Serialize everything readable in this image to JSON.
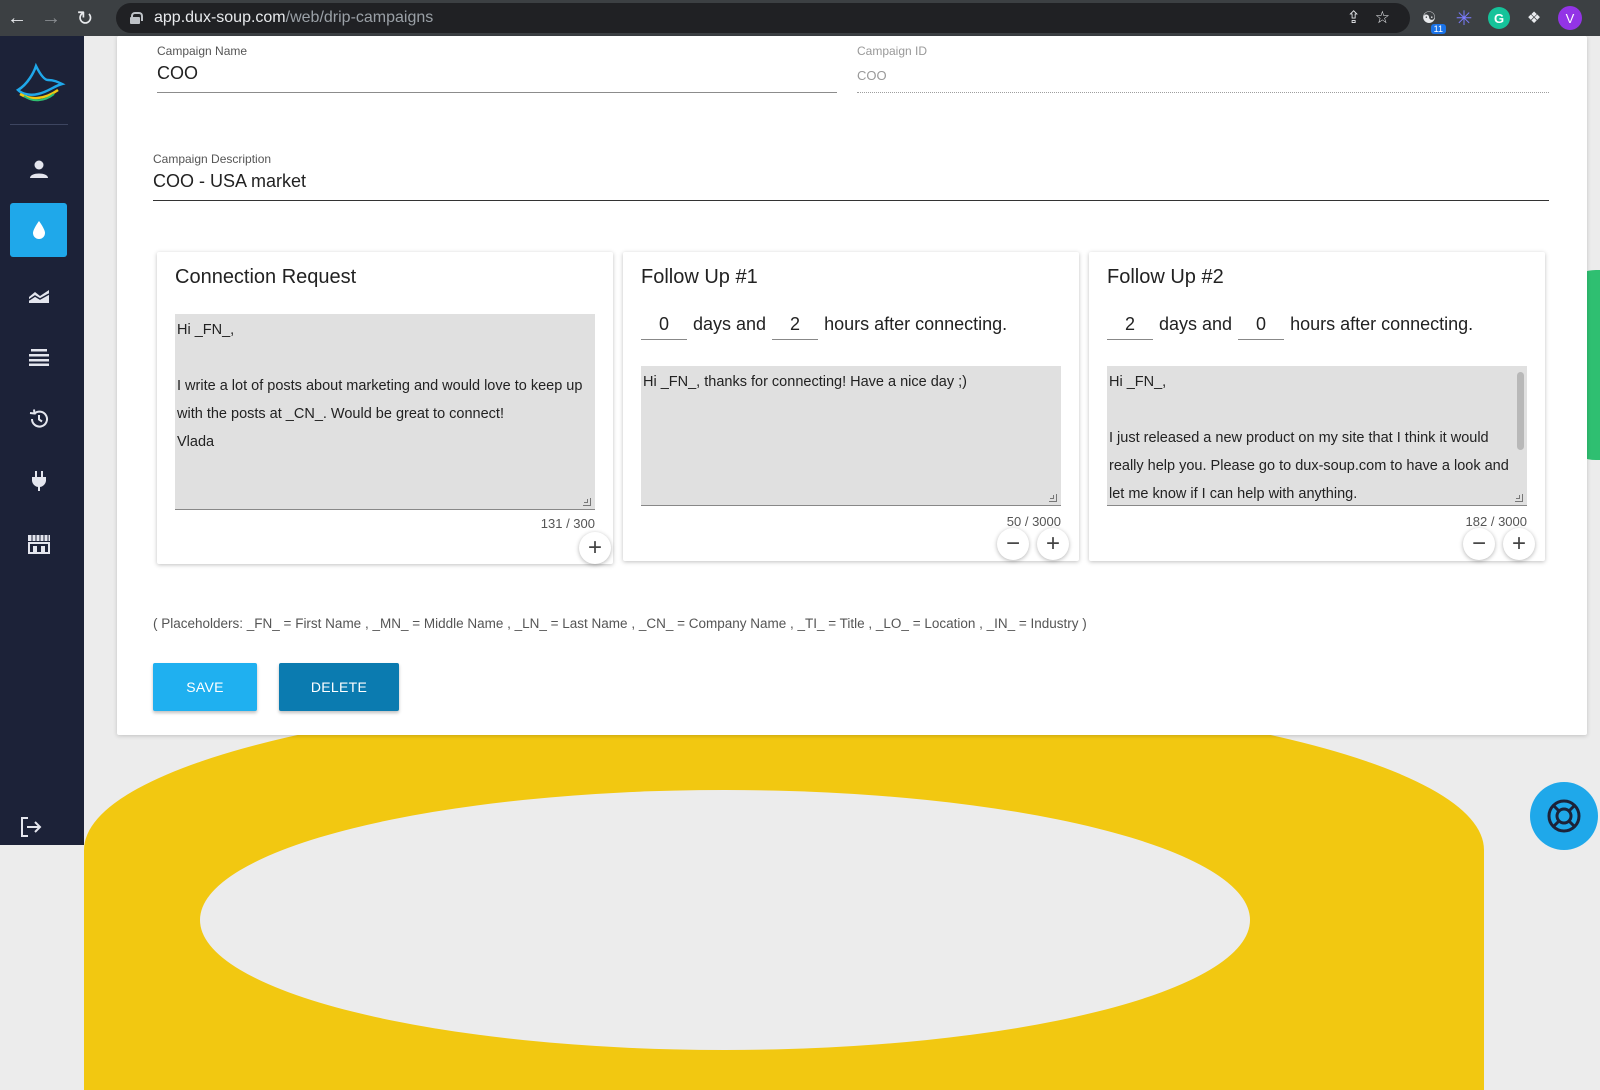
{
  "browser": {
    "url_host": "app.dux-soup.com",
    "url_path": "/web/drip-campaigns",
    "ext_badge": "11",
    "grammarly_letter": "G",
    "profile_initial": "V"
  },
  "form": {
    "campaign_name_label": "Campaign Name",
    "campaign_name_value": "COO",
    "campaign_id_label": "Campaign ID",
    "campaign_id_value": "COO",
    "description_label": "Campaign Description",
    "description_value": "COO - USA market"
  },
  "cards": [
    {
      "title": "Connection Request",
      "message": "Hi _FN_,\n\nI write a lot of posts about marketing and would love to keep up with the posts at _CN_. Would be great to connect!\nVlada",
      "counter": "131 / 300"
    },
    {
      "title": "Follow Up #1",
      "days": "0",
      "days_text": "days and",
      "hours": "2",
      "hours_text": "hours after connecting.",
      "message": "Hi _FN_, thanks for connecting! Have a nice day ;)",
      "counter": "50 / 3000"
    },
    {
      "title": "Follow Up #2",
      "days": "2",
      "days_text": "days and",
      "hours": "0",
      "hours_text": "hours after connecting.",
      "message": "Hi _FN_,\n\nI just released a new product on my site that I think it would really help you. Please go to dux-soup.com to have a look and let me know if I can help with anything.",
      "counter": "182 / 3000"
    }
  ],
  "placeholders_text": "( Placeholders: _FN_ = First Name , _MN_ = Middle Name , _LN_ = Last Name , _CN_ = Company Name , _TI_ = Title , _LO_ = Location , _IN_ = Industry )",
  "buttons": {
    "save": "SAVE",
    "delete": "DELETE",
    "add": "+",
    "remove": "−"
  },
  "colors": {
    "sidebar_bg": "#1c2238",
    "accent": "#1fa8ea",
    "save_btn": "#1fb0f0",
    "delete_btn": "#0b7bb0",
    "yellow": "#f2c811",
    "green": "#2fbf71"
  }
}
